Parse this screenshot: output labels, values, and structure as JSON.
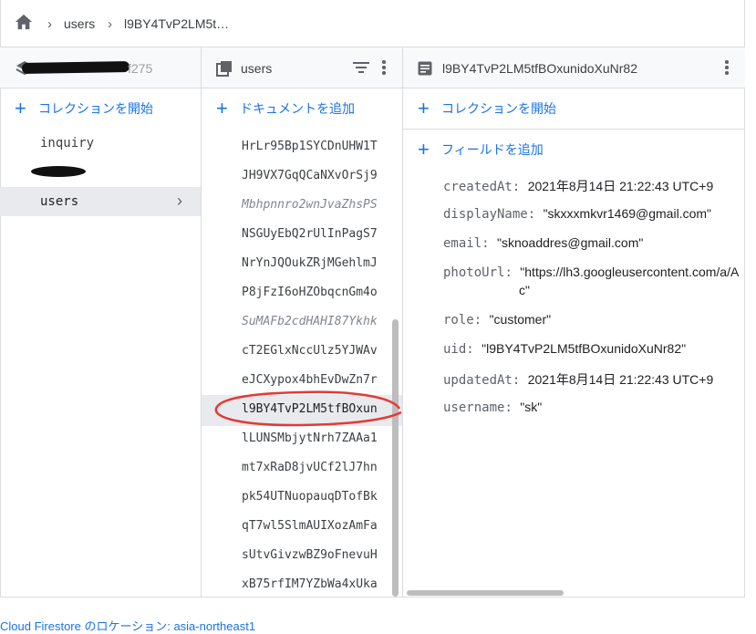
{
  "breadcrumb": {
    "items": [
      "users",
      "l9BY4TvP2LM5t…"
    ]
  },
  "project": {
    "name_visible": "f275"
  },
  "col1": {
    "add_label": "コレクションを開始",
    "items": [
      "inquiry",
      "",
      "users"
    ],
    "selected": "users"
  },
  "col2": {
    "title": "users",
    "add_label": "ドキュメントを追加",
    "docs": [
      {
        "id": "HrLr95Bp1SYCDnUHW1T",
        "italic": false
      },
      {
        "id": "JH9VX7GqQCaNXvOrSj9",
        "italic": false
      },
      {
        "id": "Mbhpnnro2wnJvaZhsPS",
        "italic": true
      },
      {
        "id": "NSGUyEbQ2rUlInPagS7",
        "italic": false
      },
      {
        "id": "NrYnJQOukZRjMGehlmJ",
        "italic": false
      },
      {
        "id": "P8jFzI6oHZObqcnGm4o",
        "italic": false
      },
      {
        "id": "SuMAFb2cdHAHI87Ykhk",
        "italic": true
      },
      {
        "id": "cT2EGlxNccUlz5YJWAv",
        "italic": false
      },
      {
        "id": "eJCXypox4bhEvDwZn7r",
        "italic": false
      },
      {
        "id": "l9BY4TvP2LM5tfBOxun",
        "italic": false
      },
      {
        "id": "lLUNSMbjytNrh7ZAAa1",
        "italic": false
      },
      {
        "id": "mt7xRaD8jvUCf2lJ7hn",
        "italic": false
      },
      {
        "id": "pk54UTNuopauqDTofBk",
        "italic": false
      },
      {
        "id": "qT7wl5SlmAUIXozAmFa",
        "italic": false
      },
      {
        "id": "sUtvGivzwBZ9oFnevuH",
        "italic": false
      },
      {
        "id": "xB75rfIM7YZbWa4xUka",
        "italic": false
      }
    ],
    "selected_index": 9
  },
  "col3": {
    "title": "l9BY4TvP2LM5tfBOxunidoXuNr82",
    "add_collection_label": "コレクションを開始",
    "add_field_label": "フィールドを追加",
    "fields": [
      {
        "key": "createdAt",
        "value": "2021年8月14日 21:22:43 UTC+9"
      },
      {
        "key": "displayName",
        "value": "\"skxxxmkvr1469@gmail.com\""
      },
      {
        "key": "email",
        "value": "\"sknoaddres@gmail.com\""
      },
      {
        "key": "photoUrl",
        "value": "\"https://lh3.googleusercontent.com/a/A",
        "value2": "c\""
      },
      {
        "key": "role",
        "value": "\"customer\""
      },
      {
        "key": "uid",
        "value": "\"l9BY4TvP2LM5tfBOxunidoXuNr82\""
      },
      {
        "key": "updatedAt",
        "value": "2021年8月14日 21:22:43 UTC+9"
      },
      {
        "key": "username",
        "value": "\"sk\""
      }
    ]
  },
  "footer": {
    "location": "Cloud Firestore のロケーション: asia-northeast1"
  },
  "colors": {
    "accent": "#1a73e8",
    "selected_bg": "#e8eaed",
    "annotation": "#e53935"
  }
}
